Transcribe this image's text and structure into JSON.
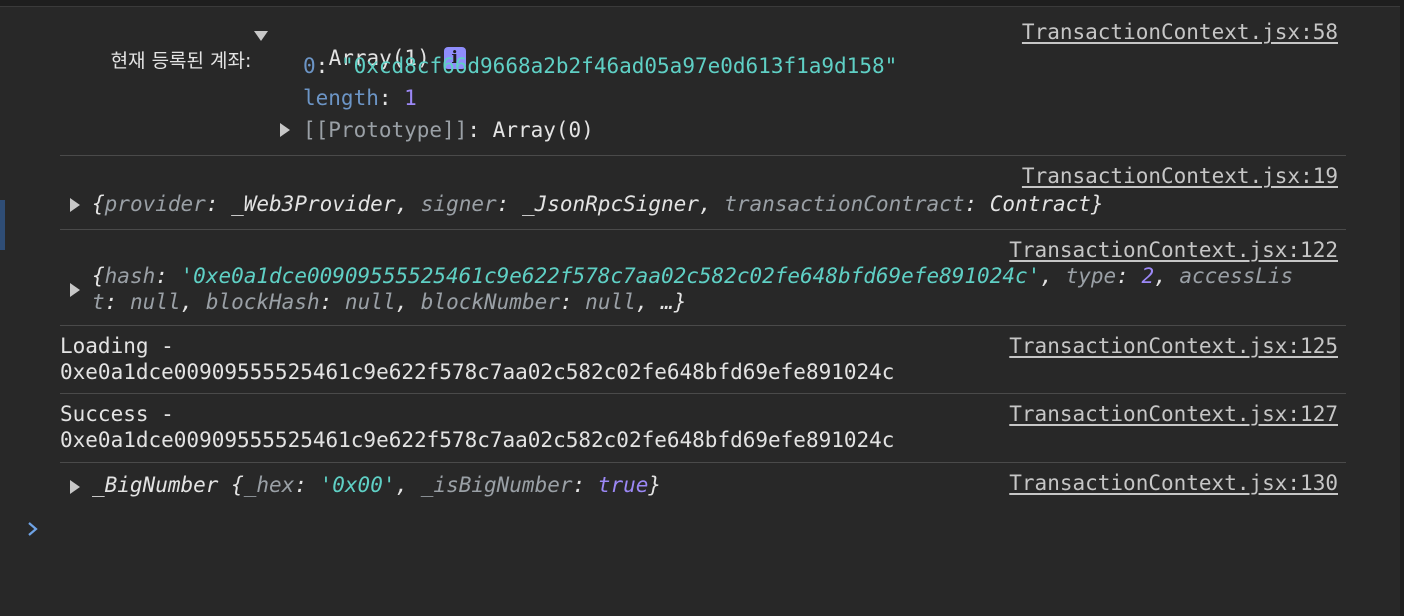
{
  "entries": [
    {
      "label": "현재 등록된 계좌:",
      "summary": "Array(1)",
      "info_icon": "i",
      "items": [
        {
          "key": "0",
          "sep": ": ",
          "value": "\"0xcd8cf66d9668a2b2f46ad05a97e0d613f1a9d158\""
        },
        {
          "key": "length",
          "sep": ": ",
          "value": "1"
        }
      ],
      "proto_key": "[[Prototype]]",
      "proto_sep": ": ",
      "proto_value": "Array(0)",
      "source": "TransactionContext.jsx:58"
    },
    {
      "source": "TransactionContext.jsx:19",
      "t": {
        "open": "{",
        "k1": "provider",
        "v1": "_Web3Provider",
        "k2": "signer",
        "v2": "_JsonRpcSigner",
        "k3": "transactionContract",
        "v3": "Contract",
        "close": "}"
      }
    },
    {
      "source": "TransactionContext.jsx:122",
      "t": {
        "open": "{",
        "k_hash": "hash",
        "v_hash": "'0xe0a1dce00909555525461c9e622f578c7aa02c582c02fe648bfd69efe891024c'",
        "k_type": "type",
        "v_type": "2",
        "k_al1": "accessLis",
        "k_al2": "t",
        "v_al": "null",
        "k_bh": "blockHash",
        "v_bh": "null",
        "k_bn": "blockNumber",
        "v_bn": "null",
        "ellipsis": "…}"
      }
    },
    {
      "source": "TransactionContext.jsx:125",
      "line1": "Loading -",
      "line2": "0xe0a1dce00909555525461c9e622f578c7aa02c582c02fe648bfd69efe891024c"
    },
    {
      "source": "TransactionContext.jsx:127",
      "line1": "Success -",
      "line2": "0xe0a1dce00909555525461c9e622f578c7aa02c582c02fe648bfd69efe891024c"
    },
    {
      "source": "TransactionContext.jsx:130",
      "t": {
        "name": "_BigNumber",
        "open": "{",
        "k_hex": "_hex",
        "v_hex": "'0x00'",
        "k_is": "_isBigNumber",
        "v_is": "true",
        "close": "}"
      }
    }
  ],
  "prompt_icon": "chevron-right-icon",
  "colors": {
    "background": "#282828",
    "string": "#5fd0c5",
    "number": "#9c88f6",
    "key": "#6c95c6",
    "prompt": "#6fa3e6"
  }
}
